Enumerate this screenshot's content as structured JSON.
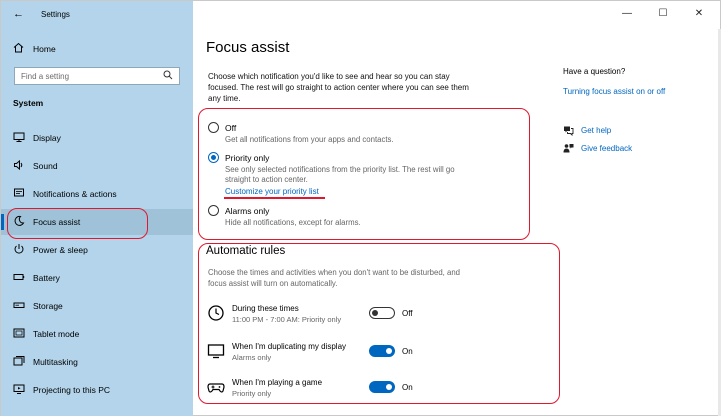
{
  "window": {
    "title": "Settings",
    "controls": {
      "minimize": "—",
      "maximize": "☐",
      "close": "✕"
    }
  },
  "sidebar": {
    "home_label": "Home",
    "search_placeholder": "Find a setting",
    "section": "System",
    "items": [
      {
        "label": "Display",
        "icon": "display-icon"
      },
      {
        "label": "Sound",
        "icon": "sound-icon"
      },
      {
        "label": "Notifications & actions",
        "icon": "notifications-icon"
      },
      {
        "label": "Focus assist",
        "icon": "moon-icon",
        "active": true
      },
      {
        "label": "Power & sleep",
        "icon": "power-icon"
      },
      {
        "label": "Battery",
        "icon": "battery-icon"
      },
      {
        "label": "Storage",
        "icon": "storage-icon"
      },
      {
        "label": "Tablet mode",
        "icon": "tablet-icon"
      },
      {
        "label": "Multitasking",
        "icon": "multitasking-icon"
      },
      {
        "label": "Projecting to this PC",
        "icon": "projecting-icon"
      }
    ]
  },
  "main": {
    "title": "Focus assist",
    "intro": "Choose which notification you'd like to see and hear so you can stay focused. The rest will go straight to action center where you can see them any time.",
    "options": [
      {
        "title": "Off",
        "desc": "Get all notifications from your apps and contacts.",
        "checked": false
      },
      {
        "title": "Priority only",
        "desc": "See only selected notifications from the priority list. The rest will go straight to action center.",
        "link": "Customize your priority list",
        "checked": true
      },
      {
        "title": "Alarms only",
        "desc": "Hide all notifications, except for alarms.",
        "checked": false
      }
    ],
    "rules": {
      "title": "Automatic rules",
      "desc": "Choose the times and activities when you don't want to be disturbed, and focus assist will turn on automatically.",
      "items": [
        {
          "title": "During these times",
          "sub": "11:00 PM - 7:00 AM: Priority only",
          "state": "Off",
          "icon": "clock-icon"
        },
        {
          "title": "When I'm duplicating my display",
          "sub": "Alarms only",
          "state": "On",
          "icon": "monitor-icon"
        },
        {
          "title": "When I'm playing a game",
          "sub": "Priority only",
          "state": "On",
          "icon": "gamepad-icon"
        }
      ]
    }
  },
  "aside": {
    "title": "Have a question?",
    "link": "Turning focus assist on or off",
    "help": "Get help",
    "feedback": "Give feedback"
  },
  "colors": {
    "sidebar_bg": "#b3d4ea",
    "accent": "#0067c0",
    "highlight": "#e0182d"
  }
}
